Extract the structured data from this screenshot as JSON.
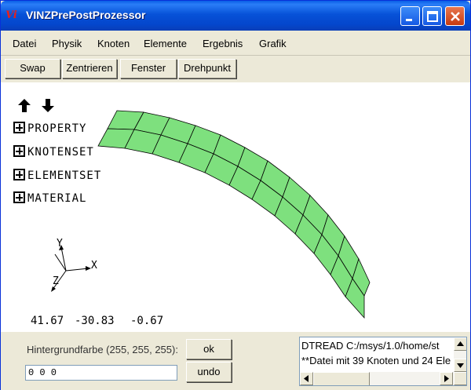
{
  "window": {
    "title": "VINZPrePostProzessor",
    "icon_text": "Vi"
  },
  "menu": [
    "Datei",
    "Physik",
    "Knoten",
    "Elemente",
    "Ergebnis",
    "Grafik"
  ],
  "toolbar": [
    "Swap",
    "Zentrieren",
    "Fenster",
    "Drehpunkt"
  ],
  "tree": [
    "PROPERTY",
    "KNOTENSET",
    "ELEMENTSET",
    "MATERIAL"
  ],
  "axes": {
    "x": "X",
    "y": "Y",
    "z": "Z"
  },
  "coordinates": [
    "41.67",
    "-30.83",
    "-0.67"
  ],
  "mesh": {
    "fill_color": "#7ee07e",
    "edge_color": "#000000"
  },
  "background": {
    "label": "Hintergrundfarbe (255, 255, 255):",
    "value": "0 0 0"
  },
  "buttons": {
    "ok": "ok",
    "undo": "undo"
  },
  "log": [
    "DTREAD C:/msys/1.0/home/st",
    "**Datei mit 39 Knoten und 24 Ele"
  ],
  "colors": {
    "titlebar": "#0a5fe6",
    "close_button": "#d5491a",
    "canvas": "#ffffff"
  }
}
